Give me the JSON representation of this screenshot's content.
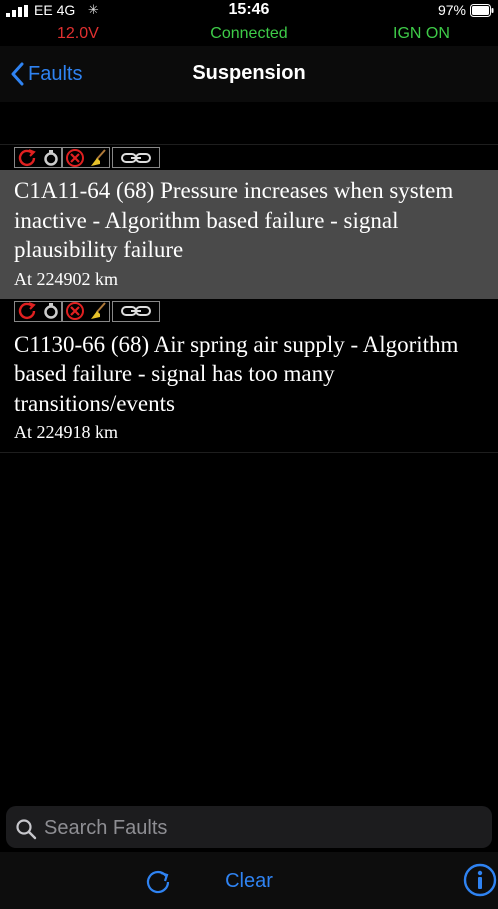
{
  "status": {
    "carrier": "EE  4G",
    "time": "15:46",
    "battery": "97%"
  },
  "vehicle": {
    "voltage": "12.0V",
    "connection": "Connected",
    "ignition": "IGN ON"
  },
  "nav": {
    "back_label": "Faults",
    "title": "Suspension"
  },
  "faults": [
    {
      "description": "C1A11-64 (68) Pressure increases when system inactive - Algorithm based failure - signal plausibility failure",
      "distance": "At 224902 km",
      "selected": true
    },
    {
      "description": "C1130-66 (68) Air spring air supply - Algorithm based failure - signal has too many transitions/events",
      "distance": "At 224918 km",
      "selected": false
    }
  ],
  "search": {
    "placeholder": "Search Faults",
    "value": ""
  },
  "toolbar": {
    "clear_label": "Clear"
  },
  "colors": {
    "accent": "#2f83f2",
    "ok": "#3ecb48",
    "warn": "#e03030"
  }
}
